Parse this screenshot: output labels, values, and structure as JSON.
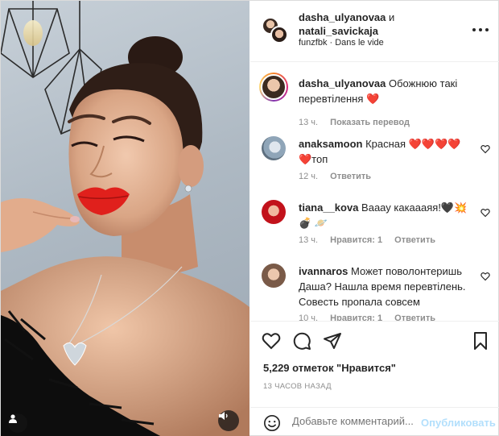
{
  "header": {
    "user1": "dasha_ulyanovaa",
    "joiner": " и",
    "user2": "natali_savickaja",
    "subtitle": "funzfbk · Dans le vide"
  },
  "comments": [
    {
      "user": "dasha_ulyanovaa",
      "text": " Обожнюю такі перевтілення ❤️",
      "time": "13 ч.",
      "action": "Показать перевод"
    },
    {
      "user": "anaksamoon",
      "text": " Красная ❤️❤️❤️❤️ ❤️топ",
      "time": "12 ч.",
      "action": "Ответить"
    },
    {
      "user": "tiana__kova",
      "text": " Вааау какаааяя!🖤💥💣 🪐",
      "time": "13 ч.",
      "likes": "Нравится: 1",
      "action": "Ответить"
    },
    {
      "user": "ivannaros",
      "text": " Может поволонтеришь Даша? Нашла время перевтілень. Совесть пропала совсем",
      "time": "10 ч.",
      "likes": "Нравится: 1",
      "action": "Ответить"
    }
  ],
  "likes_count": "5,229 отметок \"Нравится\"",
  "timestamp": "13 ЧАСОВ НАЗАД",
  "add_comment": {
    "placeholder": "Добавьте комментарий...",
    "publish": "Опубликовать"
  },
  "icons": {
    "like": "heart-outline-icon",
    "comment": "speech-bubble-icon",
    "share": "paper-plane-icon",
    "save": "bookmark-icon",
    "emoji": "smiley-icon",
    "more": "ellipsis-icon",
    "user_tag": "user-icon",
    "sound": "speaker-muted-icon"
  },
  "colors": {
    "text": "#262626",
    "muted": "#8e8e8e",
    "publish_disabled": "#b2dffc",
    "lips": "#e0201c"
  }
}
